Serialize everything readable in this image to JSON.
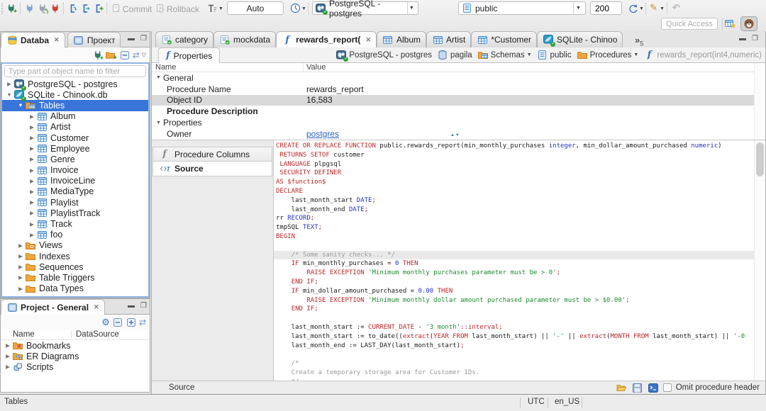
{
  "colors": {
    "selection_blue": "#3974d9",
    "syntax_keyword": "#be2626",
    "syntax_type": "#2233cc",
    "syntax_string": "#1e8a2e",
    "syntax_comment": "#9a9a9a",
    "syntax_number": "#2233cc",
    "link_blue": "#2a63c8",
    "folder_orange": "#f0a63c"
  },
  "toolbar": {
    "commit_label": "Commit",
    "rollback_label": "Rollback",
    "auto_label": "Auto",
    "connection_value": "PostgreSQL - postgres",
    "schema_value": "public",
    "fetch_size": "200",
    "quick_access_placeholder": "Quick Access"
  },
  "navigator": {
    "tab_database": "Databa",
    "tab_project": "Проект",
    "filter_placeholder": "Type part of object name to filter",
    "tree": [
      {
        "label": "PostgreSQL - postgres",
        "icon": "postgres",
        "level": 0,
        "arrow": "right"
      },
      {
        "label": "SQLite - Chinook.db",
        "icon": "sqlite",
        "level": 0,
        "arrow": "down"
      },
      {
        "label": "Tables",
        "icon": "folder-tables",
        "level": 1,
        "arrow": "down",
        "selected": true
      },
      {
        "label": "Album",
        "icon": "table",
        "level": 2,
        "arrow": "right"
      },
      {
        "label": "Artist",
        "icon": "table",
        "level": 2,
        "arrow": "right"
      },
      {
        "label": "Customer",
        "icon": "table",
        "level": 2,
        "arrow": "right"
      },
      {
        "label": "Employee",
        "icon": "table",
        "level": 2,
        "arrow": "right"
      },
      {
        "label": "Genre",
        "icon": "table",
        "level": 2,
        "arrow": "right"
      },
      {
        "label": "Invoice",
        "icon": "table",
        "level": 2,
        "arrow": "right"
      },
      {
        "label": "InvoiceLine",
        "icon": "table",
        "level": 2,
        "arrow": "right"
      },
      {
        "label": "MediaType",
        "icon": "table",
        "level": 2,
        "arrow": "right"
      },
      {
        "label": "Playlist",
        "icon": "table",
        "level": 2,
        "arrow": "right"
      },
      {
        "label": "PlaylistTrack",
        "icon": "table",
        "level": 2,
        "arrow": "right"
      },
      {
        "label": "Track",
        "icon": "table",
        "level": 2,
        "arrow": "right"
      },
      {
        "label": "foo",
        "icon": "table",
        "level": 2,
        "arrow": "right"
      },
      {
        "label": "Views",
        "icon": "folder-views",
        "level": 1,
        "arrow": "right"
      },
      {
        "label": "Indexes",
        "icon": "folder",
        "level": 1,
        "arrow": "right"
      },
      {
        "label": "Sequences",
        "icon": "folder",
        "level": 1,
        "arrow": "right"
      },
      {
        "label": "Table Triggers",
        "icon": "folder",
        "level": 1,
        "arrow": "right"
      },
      {
        "label": "Data Types",
        "icon": "folder",
        "level": 1,
        "arrow": "right"
      }
    ]
  },
  "project_panel": {
    "title": "Project - General",
    "col_name": "Name",
    "col_datasource": "DataSource",
    "items": [
      {
        "label": "Bookmarks",
        "icon": "folder-bookmarks"
      },
      {
        "label": "ER Diagrams",
        "icon": "folder-er"
      },
      {
        "label": "Scripts",
        "icon": "scripts"
      }
    ]
  },
  "editor": {
    "tabs": [
      {
        "label": "category",
        "icon": "sql-file"
      },
      {
        "label": "mockdata",
        "icon": "sql-file"
      },
      {
        "label": "rewards_report(",
        "icon": "function",
        "active": true,
        "closable": true
      },
      {
        "label": "Album",
        "icon": "table"
      },
      {
        "label": "Artist",
        "icon": "table"
      },
      {
        "label": "*Customer",
        "icon": "table"
      },
      {
        "label": "SQLite - Chinoo",
        "icon": "sqlite"
      }
    ],
    "overflow_count": "5",
    "properties_tab_label": "Properties",
    "breadcrumb": [
      {
        "label": "PostgreSQL - postgres",
        "icon": "postgres"
      },
      {
        "label": "pagila",
        "icon": "database"
      },
      {
        "label": "Schemas",
        "icon": "folder-schemas",
        "dropdown": true
      },
      {
        "label": "public",
        "icon": "schema"
      },
      {
        "label": "Procedures",
        "icon": "folder",
        "dropdown": true
      },
      {
        "label": "rewards_report(int4,numeric)",
        "icon": "function",
        "muted": true
      }
    ],
    "properties_table": {
      "col_name": "Name",
      "col_value": "Value",
      "rows": [
        {
          "name": "General",
          "group": true
        },
        {
          "name": "Procedure Name",
          "value": "rewards_report"
        },
        {
          "name": "Object ID",
          "value": "16,583",
          "selected": true
        },
        {
          "name": "Procedure Description",
          "bold": true
        },
        {
          "name": "Properties",
          "group": true
        },
        {
          "name": "Owner",
          "value": "postgres",
          "link": true
        }
      ]
    },
    "subtabs": [
      {
        "label": "Procedure Columns",
        "icon": "function-gray"
      },
      {
        "label": "Source",
        "icon": "source",
        "active": true
      }
    ],
    "bottom_label": "Source",
    "omit_checkbox_label": "Omit procedure header"
  },
  "statusbar": {
    "left": "Tables",
    "timezone": "UTC",
    "locale": "en_US"
  },
  "source_code": {
    "current_line": 12,
    "lines": [
      [
        [
          "k",
          "CREATE OR REPLACE FUNCTION"
        ],
        [
          "p",
          " public.rewards_report(min_monthly_purchases "
        ],
        [
          "t",
          "integer"
        ],
        [
          "p",
          ", min_dollar_amount_purchased "
        ],
        [
          "t",
          "numeric"
        ],
        [
          "p",
          ")"
        ]
      ],
      [
        [
          "p",
          " "
        ],
        [
          "k",
          "RETURNS SETOF"
        ],
        [
          "p",
          " customer"
        ]
      ],
      [
        [
          "p",
          " "
        ],
        [
          "k",
          "LANGUAGE"
        ],
        [
          "p",
          " plpgsql"
        ]
      ],
      [
        [
          "p",
          " "
        ],
        [
          "k",
          "SECURITY DEFINER"
        ]
      ],
      [
        [
          "k",
          "AS $function$"
        ]
      ],
      [
        [
          "k",
          "DECLARE"
        ]
      ],
      [
        [
          "p",
          "    last_month_start "
        ],
        [
          "t",
          "DATE"
        ],
        [
          "k",
          ";"
        ]
      ],
      [
        [
          "p",
          "    last_month_end "
        ],
        [
          "t",
          "DATE"
        ],
        [
          "k",
          ";"
        ]
      ],
      [
        [
          "p",
          "rr "
        ],
        [
          "t",
          "RECORD"
        ],
        [
          "k",
          ";"
        ]
      ],
      [
        [
          "p",
          "tmpSQL "
        ],
        [
          "t",
          "TEXT"
        ],
        [
          "k",
          ";"
        ]
      ],
      [
        [
          "k",
          "BEGIN"
        ]
      ],
      [],
      [
        [
          "c",
          "    /* Some sanity checks... */"
        ]
      ],
      [
        [
          "p",
          "    "
        ],
        [
          "k",
          "IF"
        ],
        [
          "p",
          " min_monthly_purchases = "
        ],
        [
          "n",
          "0"
        ],
        [
          "p",
          " "
        ],
        [
          "k",
          "THEN"
        ]
      ],
      [
        [
          "p",
          "        "
        ],
        [
          "k",
          "RAISE EXCEPTION"
        ],
        [
          "p",
          " "
        ],
        [
          "s",
          "'Minimum monthly purchases parameter must be > 0'"
        ],
        [
          "k",
          ";"
        ]
      ],
      [
        [
          "p",
          "    "
        ],
        [
          "k",
          "END IF;"
        ]
      ],
      [
        [
          "p",
          "    "
        ],
        [
          "k",
          "IF"
        ],
        [
          "p",
          " min_dollar_amount_purchased = "
        ],
        [
          "n",
          "0.00"
        ],
        [
          "p",
          " "
        ],
        [
          "k",
          "THEN"
        ]
      ],
      [
        [
          "p",
          "        "
        ],
        [
          "k",
          "RAISE EXCEPTION"
        ],
        [
          "p",
          " "
        ],
        [
          "s",
          "'Minimum monthly dollar amount purchased parameter must be > $0.00'"
        ],
        [
          "k",
          ";"
        ]
      ],
      [
        [
          "p",
          "    "
        ],
        [
          "k",
          "END IF;"
        ]
      ],
      [],
      [
        [
          "p",
          "    last_month_start := "
        ],
        [
          "k",
          "CURRENT_DATE"
        ],
        [
          "p",
          " - "
        ],
        [
          "s",
          "'3 month'"
        ],
        [
          "k",
          "::interval;"
        ]
      ],
      [
        [
          "p",
          "    last_month_start := to_date(("
        ],
        [
          "k",
          "extract"
        ],
        [
          "p",
          "("
        ],
        [
          "k",
          "YEAR FROM"
        ],
        [
          "p",
          " last_month_start) || "
        ],
        [
          "s",
          "'-'"
        ],
        [
          "p",
          " || "
        ],
        [
          "k",
          "extract"
        ],
        [
          "p",
          "("
        ],
        [
          "k",
          "MONTH FROM"
        ],
        [
          "p",
          " last_month_start) || "
        ],
        [
          "s",
          "'-0"
        ]
      ],
      [
        [
          "p",
          "    last_month_end := LAST_DAY(last_month_start)"
        ],
        [
          "k",
          ";"
        ]
      ],
      [],
      [
        [
          "c",
          "    /*"
        ]
      ],
      [
        [
          "c",
          "    Create a temporary storage area for Customer IDs."
        ]
      ],
      [
        [
          "c",
          "    */"
        ]
      ]
    ]
  }
}
